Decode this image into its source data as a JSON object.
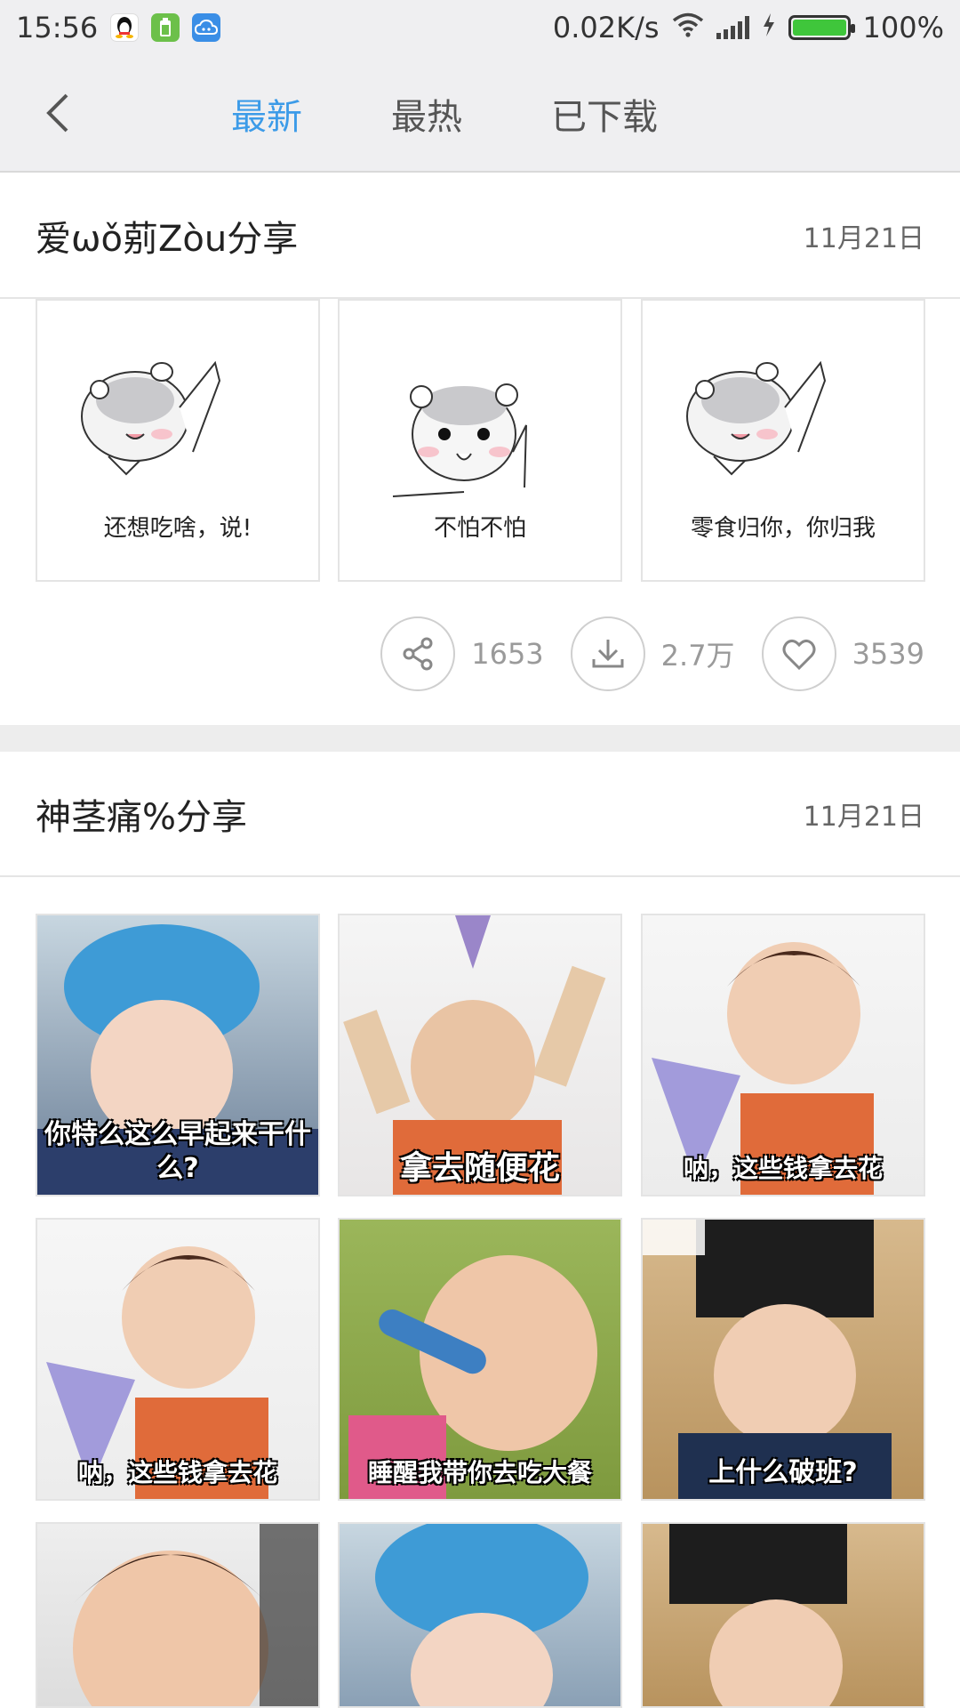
{
  "status_bar": {
    "time": "15:56",
    "network_speed": "0.02K/s",
    "battery_percent": "100%",
    "icons": [
      "qq-icon",
      "battery-saver-icon",
      "cloud-icon",
      "wifi-icon",
      "signal-icon",
      "charging-icon",
      "battery-icon"
    ]
  },
  "header": {
    "back_icon": "chevron-left-icon",
    "tabs": [
      {
        "label": "最新",
        "active": true
      },
      {
        "label": "最热",
        "active": false
      },
      {
        "label": "已下载",
        "active": false
      }
    ],
    "active_color": "#3c9be8"
  },
  "cards": [
    {
      "title": "爱ωǒ莂Zòu分享",
      "date": "11月21日",
      "stickers": [
        {
          "caption": "还想吃啥，说!"
        },
        {
          "caption": "不怕不怕"
        },
        {
          "caption": "零食归你，你归我"
        }
      ],
      "actions": {
        "share_count": "1653",
        "download_count": "2.7万",
        "like_count": "3539"
      }
    },
    {
      "title": "神茎痛%分享",
      "date": "11月21日",
      "photos": [
        {
          "caption": "你特么这么早起来干什么?"
        },
        {
          "caption": "拿去随便花"
        },
        {
          "caption": "呐，这些钱拿去花"
        },
        {
          "caption": "呐，这些钱拿去花"
        },
        {
          "caption": "睡醒我带你去吃大餐"
        },
        {
          "caption": "上什么破班?"
        },
        {
          "caption": ""
        },
        {
          "caption": ""
        },
        {
          "caption": ""
        }
      ]
    }
  ]
}
